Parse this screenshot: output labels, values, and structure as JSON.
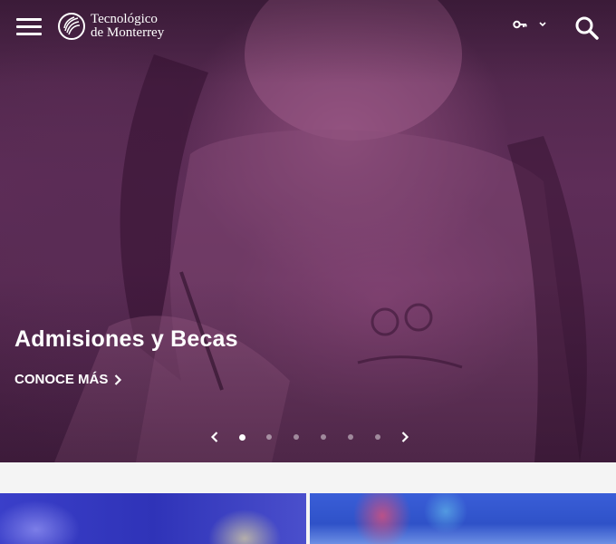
{
  "header": {
    "menu_icon": "hamburger-menu-icon",
    "logo": {
      "line1": "Tecnológico",
      "line2": "de Monterrey"
    },
    "key_icon": "key-icon",
    "dropdown_icon": "chevron-down-icon",
    "search_icon": "search-icon"
  },
  "hero": {
    "title": "Admisiones y Becas",
    "cta_label": "CONOCE MÁS",
    "cta_icon": "chevron-right-icon",
    "prev_icon": "chevron-left-icon",
    "next_icon": "chevron-right-icon",
    "slide_count": 6,
    "active_slide": 1
  },
  "cards": [
    {
      "name": "card-students-image"
    },
    {
      "name": "card-building-image"
    }
  ],
  "colors": {
    "hero_tint": "#5e2d58",
    "card_tint": "#3a3fc9",
    "page_bg": "#f4f4f4"
  }
}
